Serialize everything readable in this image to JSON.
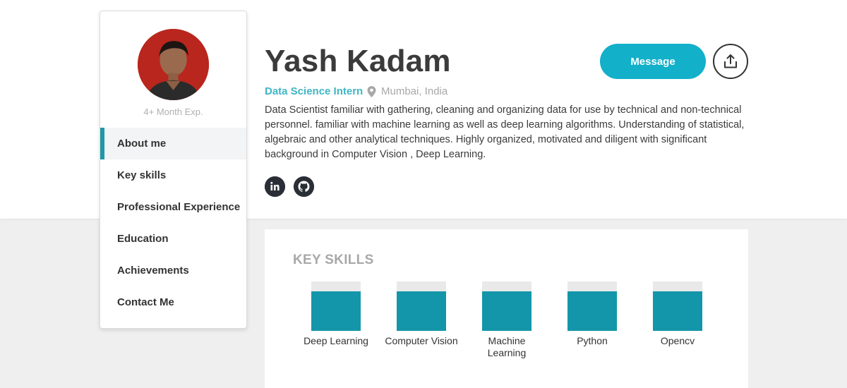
{
  "profile": {
    "experience": "4+ Month Exp.",
    "name": "Yash Kadam",
    "role": "Data Science Intern",
    "location": "Mumbai, India",
    "bio": "Data Scientist familiar with gathering, cleaning and organizing data for use by technical and non-technical personnel. familiar with machine learning as well as deep learning algorithms. Understanding of statistical, algebraic and other analytical techniques. Highly organized, motivated and diligent with significant background in Computer Vision , Deep Learning."
  },
  "nav": {
    "items": [
      {
        "label": "About me",
        "active": true
      },
      {
        "label": "Key skills",
        "active": false
      },
      {
        "label": "Professional Experience",
        "active": false
      },
      {
        "label": "Education",
        "active": false
      },
      {
        "label": "Achievements",
        "active": false
      },
      {
        "label": "Contact Me",
        "active": false
      }
    ]
  },
  "actions": {
    "message_label": "Message",
    "share_icon": "share-upload-icon"
  },
  "social": [
    {
      "icon": "linkedin-icon"
    },
    {
      "icon": "github-icon"
    }
  ],
  "skills": {
    "title": "KEY SKILLS",
    "items": [
      {
        "label": "Deep Learning",
        "level": 0.8
      },
      {
        "label": "Computer Vision",
        "level": 0.8
      },
      {
        "label": "Machine Learning",
        "level": 0.8
      },
      {
        "label": "Python",
        "level": 0.8
      },
      {
        "label": "Opencv",
        "level": 0.8
      }
    ]
  },
  "colors": {
    "accent": "#12b0c9",
    "skill_fill": "#1396a9",
    "role_text": "#3fb6c4",
    "nav_active_bar": "#1f98a7"
  }
}
